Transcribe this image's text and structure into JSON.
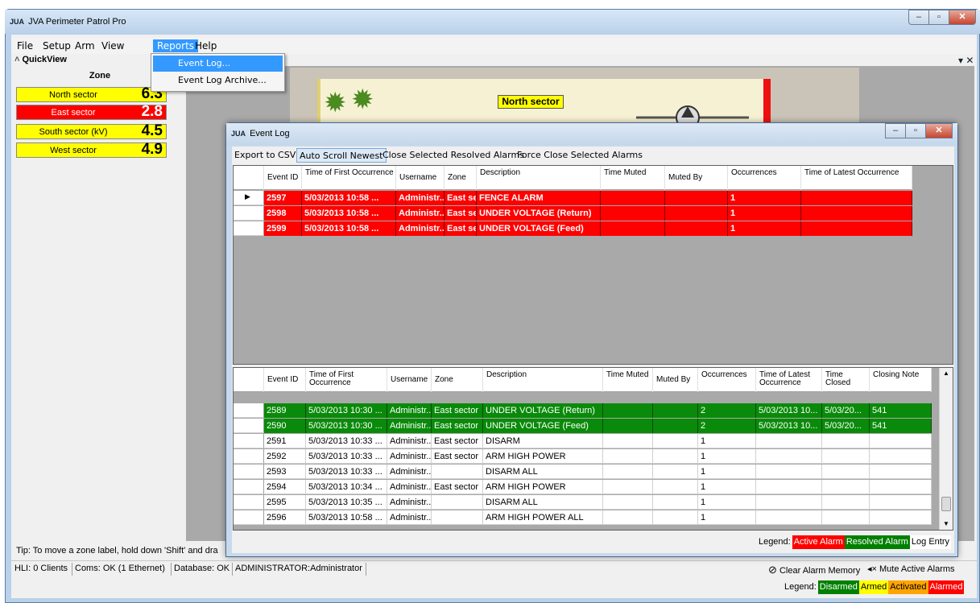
{
  "app": {
    "title": "JVA Perimeter Patrol Pro",
    "icon_text": "JUA"
  },
  "menubar": {
    "items": [
      "File",
      "Setup",
      "Arm",
      "View",
      "Reports",
      "Help"
    ],
    "active": "Reports"
  },
  "reports_menu": {
    "items": [
      "Event Log...",
      "Event Log Archive..."
    ],
    "highlighted": "Event Log..."
  },
  "quickview": {
    "title": "QuickView",
    "zone_header": "Zone",
    "zones": [
      {
        "name": "North sector",
        "value": "6.3",
        "color": "#ffff00",
        "text_color": "#000000"
      },
      {
        "name": "East sector",
        "value": "2.8",
        "color": "#ff0000",
        "text_color": "#ffffff"
      },
      {
        "name": "South sector  (kV)",
        "value": "4.5",
        "color": "#ffff00",
        "text_color": "#000000"
      },
      {
        "name": "West sector",
        "value": "4.9",
        "color": "#ffff00",
        "text_color": "#000000"
      }
    ]
  },
  "map": {
    "north_label": "North sector"
  },
  "tip": "Tip: To move a zone label, hold down 'Shift' and dra",
  "status": {
    "hli": "HLI: 0 Clients",
    "coms": "Coms: OK (1 Ethernet)",
    "database": "Database: OK",
    "user": "ADMINISTRATOR:Administrator",
    "clear_alarm": "Clear Alarm Memory",
    "mute_alarms": "Mute Active Alarms"
  },
  "main_legend": {
    "label": "Legend:",
    "items": [
      {
        "text": "Disarmed",
        "bg": "#008000",
        "fg": "#ffffff"
      },
      {
        "text": "Armed",
        "bg": "#ffff00",
        "fg": "#000000"
      },
      {
        "text": "Activated",
        "bg": "#ffa500",
        "fg": "#000000"
      },
      {
        "text": "Alarmed",
        "bg": "#ff0000",
        "fg": "#ffffff"
      }
    ]
  },
  "event_log": {
    "title": "Event Log",
    "toolbar": [
      "Export to CSV",
      "Auto Scroll Newest",
      "Close Selected Resolved Alarms",
      "Force Close Selected Alarms"
    ],
    "active_columns": [
      "Event ID",
      "Time of First Occurrence",
      "Username",
      "Zone",
      "Description",
      "Time Muted",
      "Muted By",
      "Occurrences",
      "Time of Latest Occurrence"
    ],
    "active_rows": [
      {
        "id": "2597",
        "time": "5/03/2013 10:58 ...",
        "user": "Administr...",
        "zone": "East se...",
        "desc": "FENCE ALARM",
        "muted": "",
        "muted_by": "",
        "occ": "1",
        "latest": ""
      },
      {
        "id": "2598",
        "time": "5/03/2013 10:58 ...",
        "user": "Administr...",
        "zone": "East se...",
        "desc": "UNDER VOLTAGE (Return)",
        "muted": "",
        "muted_by": "",
        "occ": "1",
        "latest": ""
      },
      {
        "id": "2599",
        "time": "5/03/2013 10:58 ...",
        "user": "Administr...",
        "zone": "East se...",
        "desc": "UNDER VOLTAGE (Feed)",
        "muted": "",
        "muted_by": "",
        "occ": "1",
        "latest": ""
      }
    ],
    "history_columns": [
      "Event ID",
      "Time of First Occurrence",
      "Username",
      "Zone",
      "Description",
      "Time Muted",
      "Muted By",
      "Occurrences",
      "Time of Latest Occurrence",
      "Time Closed",
      "Closing Note"
    ],
    "history_rows": [
      {
        "id": "2589",
        "time": "5/03/2013 10:30 ...",
        "user": "Administr...",
        "zone": "East sector",
        "desc": "UNDER VOLTAGE (Return)",
        "muted": "",
        "muted_by": "",
        "occ": "2",
        "latest": "5/03/2013 10...",
        "closed": "5/03/20...",
        "note": "541",
        "kind": "resolved"
      },
      {
        "id": "2590",
        "time": "5/03/2013 10:30 ...",
        "user": "Administr...",
        "zone": "East sector",
        "desc": "UNDER VOLTAGE (Feed)",
        "muted": "",
        "muted_by": "",
        "occ": "2",
        "latest": "5/03/2013 10...",
        "closed": "5/03/20...",
        "note": "541",
        "kind": "resolved"
      },
      {
        "id": "2591",
        "time": "5/03/2013 10:33 ...",
        "user": "Administr...",
        "zone": "East sector",
        "desc": "DISARM",
        "muted": "",
        "muted_by": "",
        "occ": "1",
        "latest": "",
        "closed": "",
        "note": "",
        "kind": "log"
      },
      {
        "id": "2592",
        "time": "5/03/2013 10:33 ...",
        "user": "Administr...",
        "zone": "East sector",
        "desc": "ARM HIGH POWER",
        "muted": "",
        "muted_by": "",
        "occ": "1",
        "latest": "",
        "closed": "",
        "note": "",
        "kind": "log"
      },
      {
        "id": "2593",
        "time": "5/03/2013 10:33 ...",
        "user": "Administr...",
        "zone": "",
        "desc": "DISARM ALL",
        "muted": "",
        "muted_by": "",
        "occ": "1",
        "latest": "",
        "closed": "",
        "note": "",
        "kind": "log"
      },
      {
        "id": "2594",
        "time": "5/03/2013 10:34 ...",
        "user": "Administr...",
        "zone": "East sector",
        "desc": "ARM HIGH POWER",
        "muted": "",
        "muted_by": "",
        "occ": "1",
        "latest": "",
        "closed": "",
        "note": "",
        "kind": "log"
      },
      {
        "id": "2595",
        "time": "5/03/2013 10:35 ...",
        "user": "Administr...",
        "zone": "",
        "desc": "DISARM ALL",
        "muted": "",
        "muted_by": "",
        "occ": "1",
        "latest": "",
        "closed": "",
        "note": "",
        "kind": "log"
      },
      {
        "id": "2596",
        "time": "5/03/2013 10:58 ...",
        "user": "Administr...",
        "zone": "",
        "desc": "ARM HIGH POWER ALL",
        "muted": "",
        "muted_by": "",
        "occ": "1",
        "latest": "",
        "closed": "",
        "note": "",
        "kind": "log"
      }
    ],
    "legend": {
      "label": "Legend:",
      "items": [
        {
          "text": "Active Alarm",
          "bg": "#ff0000",
          "fg": "#ffffff"
        },
        {
          "text": "Resolved Alarm",
          "bg": "#008000",
          "fg": "#ffffff"
        },
        {
          "text": "Log Entry",
          "bg": "#ffffff",
          "fg": "#000000"
        }
      ]
    }
  },
  "colors": {
    "active_alarm": "#ff0000",
    "resolved_alarm": "#0a8a0a",
    "menu_highlight": "#3399ff"
  }
}
